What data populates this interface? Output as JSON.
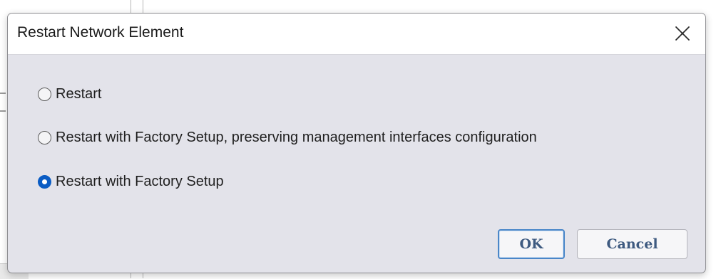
{
  "dialog": {
    "title": "Restart Network Element",
    "close_icon": "close-icon",
    "options": [
      {
        "label": "Restart",
        "checked": false
      },
      {
        "label": "Restart with Factory Setup, preserving management interfaces configuration",
        "checked": false
      },
      {
        "label": "Restart with Factory Setup",
        "checked": true
      }
    ],
    "ok_label": "OK",
    "cancel_label": "Cancel"
  },
  "colors": {
    "dialog_background": "#e3e3ea",
    "title_bar_background": "#ffffff",
    "radio_selected": "#0a5cc4",
    "ok_border": "#4a86c8",
    "button_text": "#3e5a80"
  }
}
